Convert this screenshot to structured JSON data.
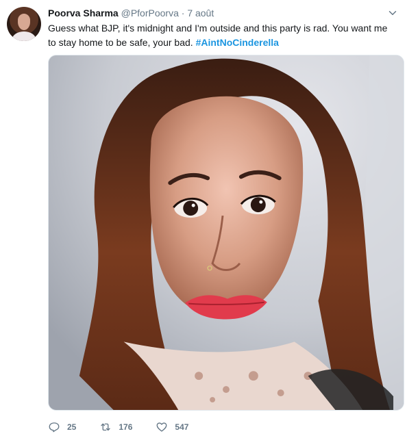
{
  "tweet": {
    "author_name": "Poorva Sharma",
    "author_handle": "@PforPoorva",
    "separator": "·",
    "date": "7 août",
    "text": "Guess what BJP, it's midnight and I'm outside and this party is rad. You want me to stay home to be safe, your bad.",
    "hashtag": "#AintNoCinderella",
    "actions": {
      "reply_count": "25",
      "retweet_count": "176",
      "like_count": "547"
    },
    "icons": {
      "caret": "chevron-down-icon",
      "reply": "reply-icon",
      "retweet": "retweet-icon",
      "like": "heart-icon"
    },
    "colors": {
      "text": "#14171a",
      "muted": "#657786",
      "link": "#1b95e0",
      "border": "#e1e8ed"
    }
  }
}
